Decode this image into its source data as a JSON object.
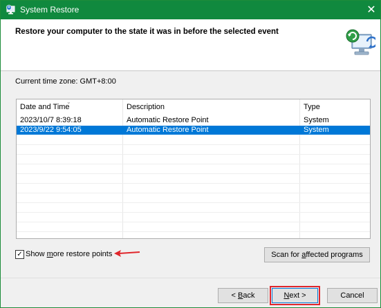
{
  "window": {
    "title": "System Restore",
    "close_glyph": "✕",
    "accent_color": "#10893e"
  },
  "header": {
    "heading": "Restore your computer to the state it was in before the selected event",
    "icon": "system-restore-icon"
  },
  "timezone": "Current time zone: GMT+8:00",
  "table": {
    "columns": [
      "Date and Time",
      "Description",
      "Type"
    ],
    "sort_indicator": "⌄",
    "rows": [
      {
        "date": "2023/10/7 8:39:18",
        "description": "Automatic Restore Point",
        "type": "System",
        "selected": false
      },
      {
        "date": "2023/9/22 9:54:05",
        "description": "Automatic Restore Point",
        "type": "System",
        "selected": true
      }
    ],
    "selection_color": "#0078d7"
  },
  "show_more": {
    "label_pre": "Show ",
    "label_u": "m",
    "label_post": "ore restore points",
    "checked": true,
    "check_glyph": "✓"
  },
  "scan_button": {
    "pre": "Scan for ",
    "u": "a",
    "post": "ffected programs"
  },
  "footer": {
    "back": {
      "pre": "< ",
      "u": "B",
      "post": "ack"
    },
    "next": {
      "pre": "",
      "u": "N",
      "post": "ext >"
    },
    "cancel": "Cancel"
  },
  "annotations": {
    "highlight_color": "#e0262b"
  }
}
